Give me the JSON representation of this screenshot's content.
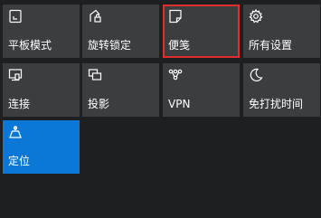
{
  "action_center": {
    "tiles": [
      {
        "label": "平板模式",
        "icon": "tablet-mode-icon",
        "active": false,
        "highlighted": false
      },
      {
        "label": "旋转锁定",
        "icon": "rotation-lock-icon",
        "active": false,
        "highlighted": false
      },
      {
        "label": "便笺",
        "icon": "note-icon",
        "active": false,
        "highlighted": true
      },
      {
        "label": "所有设置",
        "icon": "gear-icon",
        "active": false,
        "highlighted": false
      },
      {
        "label": "连接",
        "icon": "connect-icon",
        "active": false,
        "highlighted": false
      },
      {
        "label": "投影",
        "icon": "project-icon",
        "active": false,
        "highlighted": false
      },
      {
        "label": "VPN",
        "icon": "vpn-icon",
        "active": false,
        "highlighted": false
      },
      {
        "label": "免打扰时间",
        "icon": "moon-icon",
        "active": false,
        "highlighted": false
      },
      {
        "label": "定位",
        "icon": "location-icon",
        "active": true,
        "highlighted": false
      }
    ]
  },
  "colors": {
    "tile_background": "#3c3d3f",
    "active_tile": "#0b78d7",
    "highlight_outline": "#e02d2d",
    "panel_background": "#1e1f21",
    "text": "#ffffff"
  }
}
